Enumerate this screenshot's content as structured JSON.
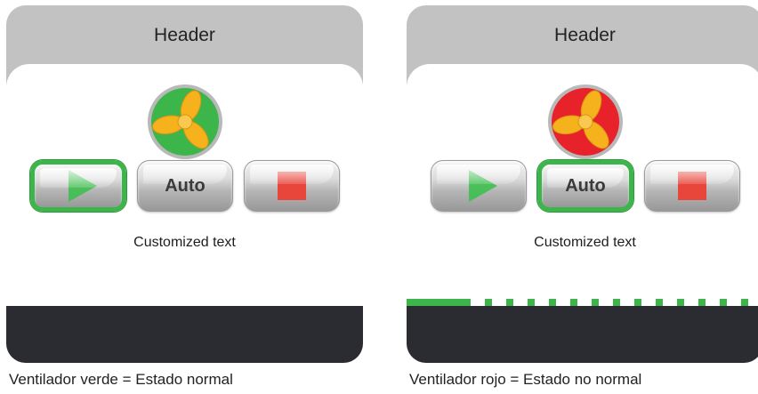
{
  "colors": {
    "state_normal": "#3cb54a",
    "state_alarm": "#e8222b",
    "fan_blade": "#f6b21c",
    "stop_red": "#e8463b",
    "play_green": "#3ec04f",
    "footer": "#2b2c31",
    "header_bg": "#c2c2c2"
  },
  "panels": [
    {
      "header": "Header",
      "fan": {
        "icon": "fan-icon",
        "ring_color": "#3cb54a"
      },
      "buttons": {
        "play": {
          "icon": "play-icon",
          "active": true
        },
        "auto": {
          "label": "Auto",
          "active": false
        },
        "stop": {
          "icon": "stop-icon",
          "active": false
        }
      },
      "text": "Customized text",
      "progress": {
        "visible": false
      },
      "caption": "Ventilador verde = Estado normal"
    },
    {
      "header": "Header",
      "fan": {
        "icon": "fan-icon",
        "ring_color": "#e8222b"
      },
      "buttons": {
        "play": {
          "icon": "play-icon",
          "active": false
        },
        "auto": {
          "label": "Auto",
          "active": true
        },
        "stop": {
          "icon": "stop-icon",
          "active": false
        }
      },
      "text": "Customized text",
      "progress": {
        "visible": true,
        "fill_fraction": 0.18
      },
      "caption": "Ventilador rojo = Estado no normal"
    }
  ]
}
